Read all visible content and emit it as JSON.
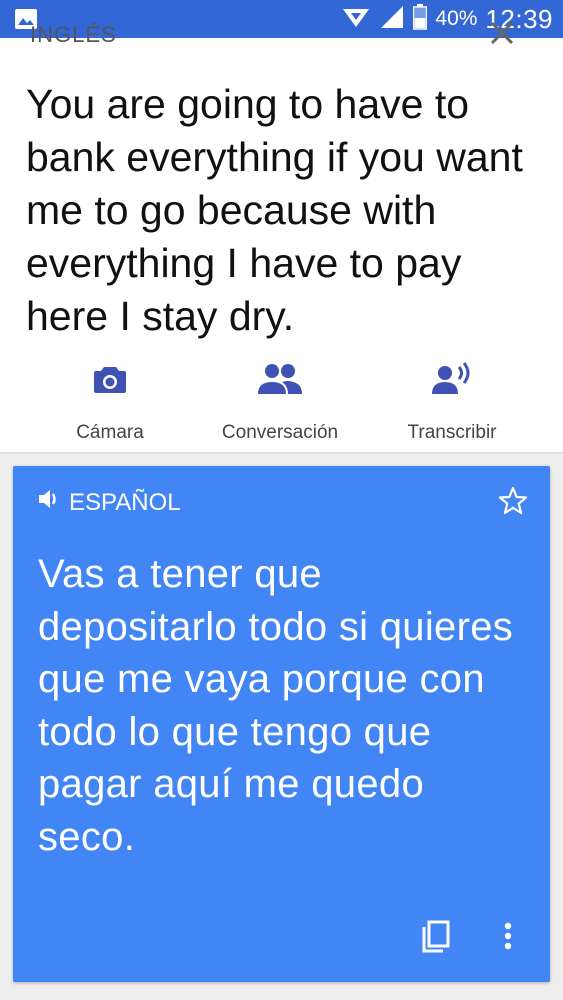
{
  "status_bar": {
    "battery_percent": "40%",
    "time": "12:39",
    "icons": [
      "image-icon",
      "data-saver-icon",
      "signal-icon",
      "battery-icon"
    ]
  },
  "source": {
    "language": "INGLÉS",
    "text": "You are going to have to bank everything if you want me to go because with everything I have to pay here I stay dry."
  },
  "actions": [
    {
      "label": "Cámara",
      "icon": "camera-icon"
    },
    {
      "label": "Conversación",
      "icon": "conversation-icon"
    },
    {
      "label": "Transcribir",
      "icon": "transcribe-icon"
    }
  ],
  "translation": {
    "language": "ESPAÑOL",
    "text": "Vas a tener que depositarlo todo si quieres que me vaya porque con todo lo que tengo que pagar aquí me quedo seco."
  },
  "colors": {
    "status_bar": "#3367d6",
    "card": "#4285f4",
    "action_icon": "#3f51b5",
    "background": "#eeeeee"
  }
}
